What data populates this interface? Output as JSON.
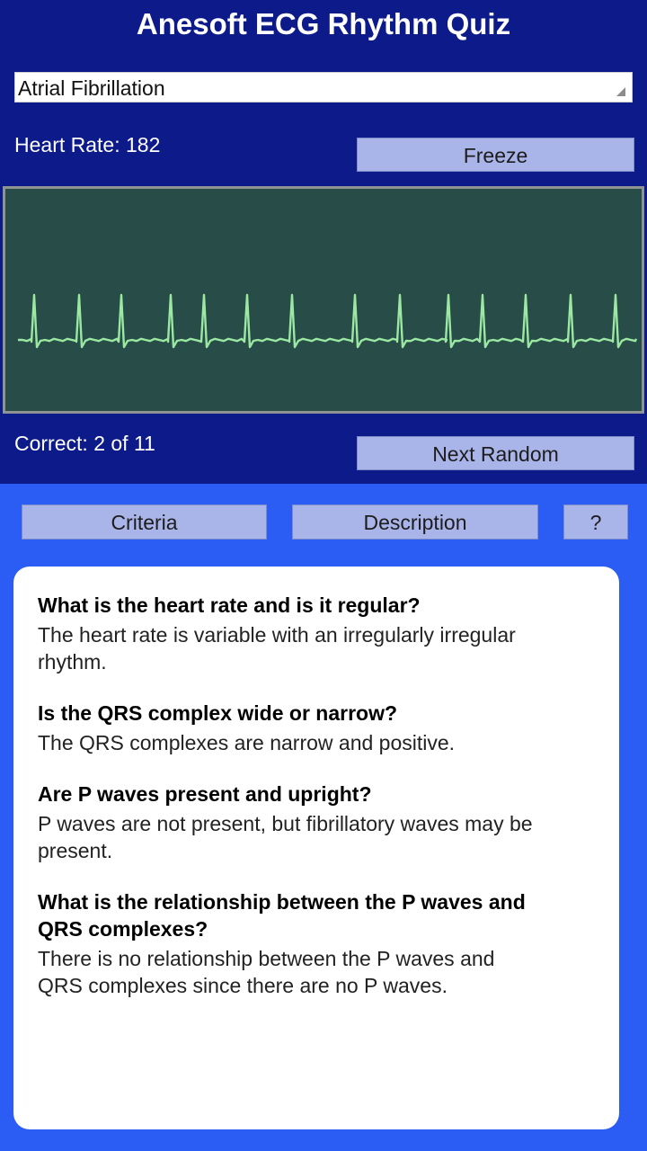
{
  "app": {
    "title": "Anesoft ECG Rhythm Quiz"
  },
  "rhythm_select": {
    "selected": "Atrial Fibrillation"
  },
  "monitor": {
    "heart_rate_label": "Heart Rate:",
    "heart_rate_value": "182",
    "freeze_label": "Freeze",
    "ecg_beats": 14,
    "trace_color": "#9ae8a1",
    "background_color": "#284c47"
  },
  "score": {
    "label": "Correct:",
    "value": "2 of 11",
    "next_label": "Next Random"
  },
  "tabs": [
    {
      "label": "Criteria"
    },
    {
      "label": "Description"
    },
    {
      "label": "?"
    }
  ],
  "criteria": [
    {
      "question": "What is the heart rate and is it regular?",
      "answer": "The heart rate is variable with an irregularly irregular rhythm."
    },
    {
      "question": "Is the QRS complex wide or narrow?",
      "answer": "The QRS complexes are narrow and positive."
    },
    {
      "question": "Are P waves present and upright?",
      "answer": "P waves are not present, but fibrillatory waves may be present."
    },
    {
      "question": "What is the relationship between the P waves and QRS complexes?",
      "answer": "There is no relationship between the P waves and QRS complexes since there are no P waves."
    }
  ],
  "colors": {
    "header_bg": "#0c1a8a",
    "body_bg": "#2b5df5",
    "button_bg": "#a9b4e8"
  }
}
